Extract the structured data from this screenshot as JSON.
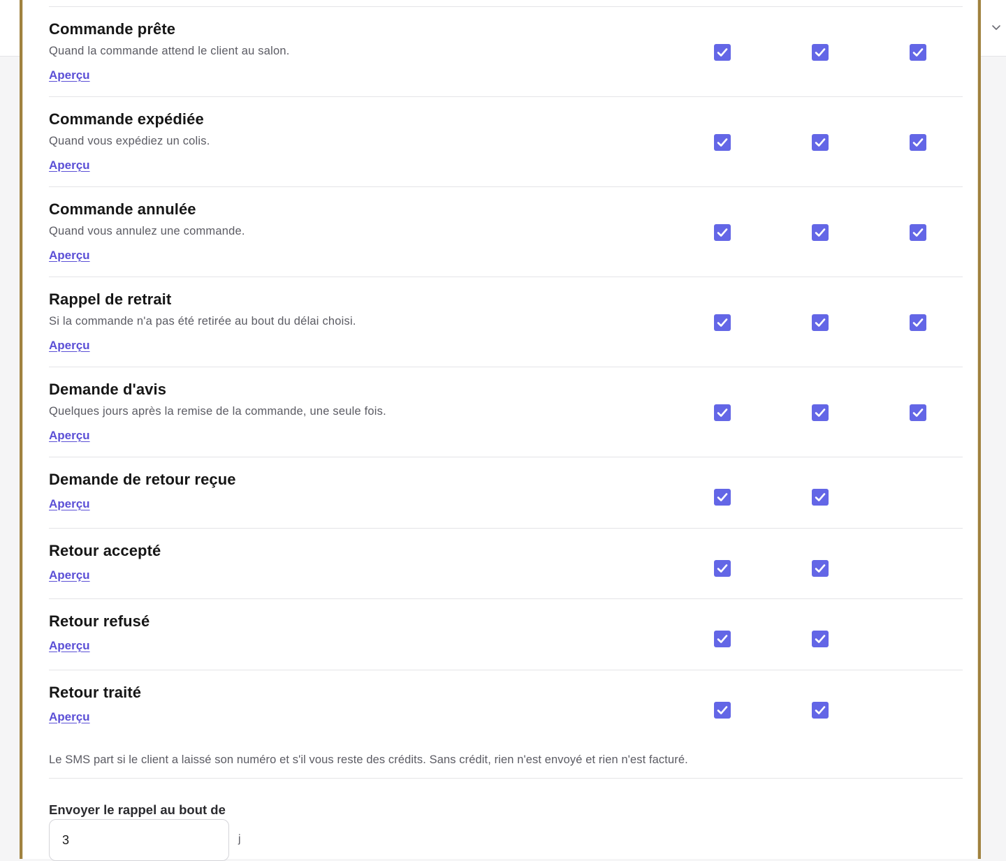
{
  "colors": {
    "accent": "#6366e6",
    "link": "#5b4fd6",
    "modal_border": "#a0823f"
  },
  "preview_label": "Aperçu",
  "rows": [
    {
      "title": "Commande prête",
      "description": "Quand la commande attend le client au salon.",
      "channels": [
        true,
        true,
        true
      ]
    },
    {
      "title": "Commande expédiée",
      "description": "Quand vous expédiez un colis.",
      "channels": [
        true,
        true,
        true
      ]
    },
    {
      "title": "Commande annulée",
      "description": "Quand vous annulez une commande.",
      "channels": [
        true,
        true,
        true
      ]
    },
    {
      "title": "Rappel de retrait",
      "description": "Si la commande n'a pas été retirée au bout du délai choisi.",
      "channels": [
        true,
        true,
        true
      ]
    },
    {
      "title": "Demande d'avis",
      "description": "Quelques jours après la remise de la commande, une seule fois.",
      "channels": [
        true,
        true,
        true
      ]
    },
    {
      "title": "Demande de retour reçue",
      "description": "",
      "channels": [
        true,
        true
      ]
    },
    {
      "title": "Retour accepté",
      "description": "",
      "channels": [
        true,
        true
      ]
    },
    {
      "title": "Retour refusé",
      "description": "",
      "channels": [
        true,
        true
      ]
    },
    {
      "title": "Retour traité",
      "description": "",
      "channels": [
        true,
        true
      ]
    }
  ],
  "footnote": "Le SMS part si le client a laissé son numéro et s'il vous reste des crédits. Sans crédit, rien n'est envoyé et rien n'est facturé.",
  "reminder": {
    "label": "Envoyer le rappel au bout de",
    "value": "3",
    "unit": "j"
  }
}
